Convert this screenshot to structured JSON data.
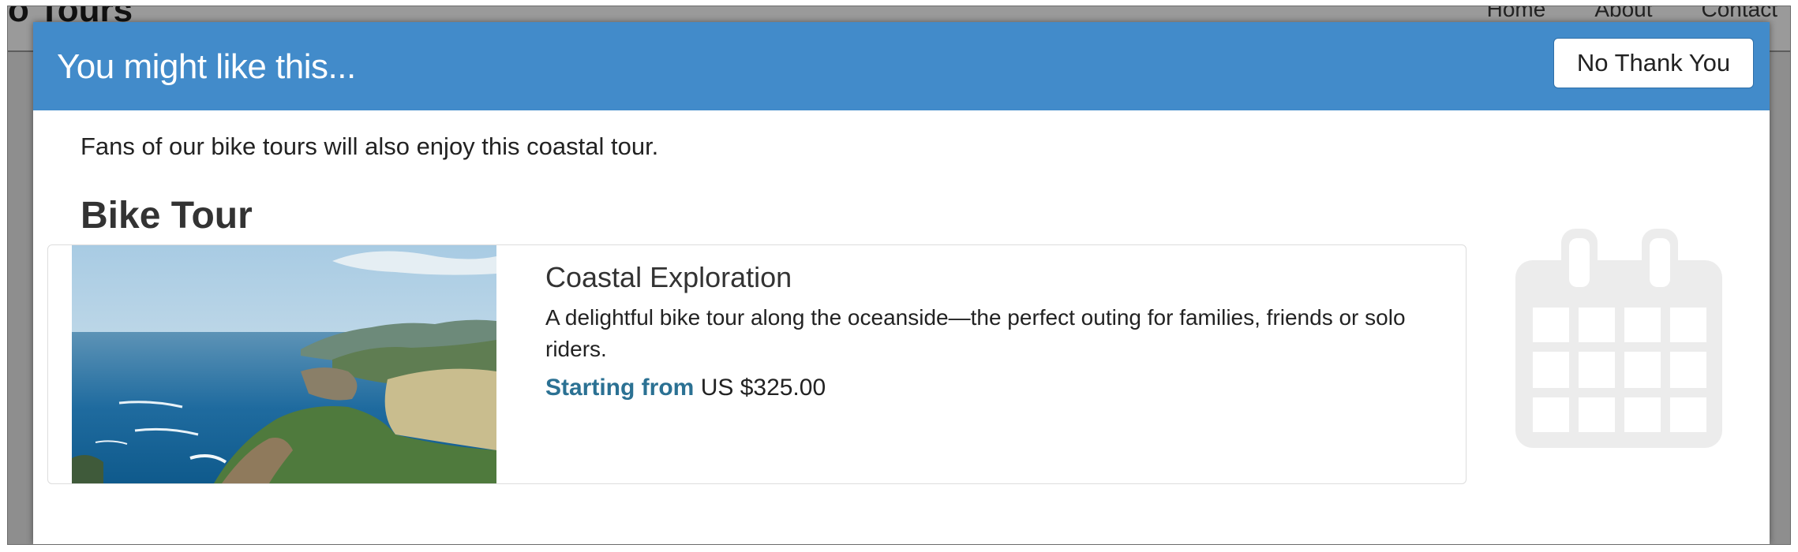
{
  "page": {
    "brand": "o Tours",
    "nav": {
      "home": "Home",
      "about": "About",
      "contact": "Contact"
    }
  },
  "modal": {
    "title": "You might like this...",
    "dismiss_label": "No Thank You",
    "intro": "Fans of our bike tours will also enjoy this coastal tour.",
    "section_heading": "Bike Tour"
  },
  "tour": {
    "name": "Coastal Exploration",
    "description": "A delightful bike tour along the oceanside—the perfect outing for families, friends or solo riders.",
    "price_label": "Starting from",
    "price_value": "US $325.00",
    "image_icon": "coastal-photo",
    "side_icon": "calendar-icon"
  },
  "colors": {
    "header_blue": "#428bca",
    "price_label": "#2b7193",
    "overlay": "#8e8e8e",
    "calendar_gray": "#ececec"
  }
}
